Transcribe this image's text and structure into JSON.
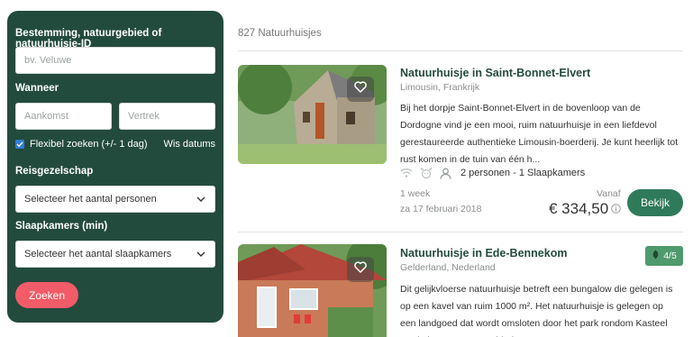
{
  "search": {
    "destination_label": "Bestemming, natuurgebied of natuurhuisje-ID",
    "destination_placeholder": "bv. Veluwe",
    "when_label": "Wanneer",
    "arrival_placeholder": "Aankomst",
    "departure_placeholder": "Vertrek",
    "flexible_label": "Flexibel zoeken (+/- 1 dag)",
    "flexible_checked": true,
    "clear_dates": "Wis datums",
    "party_label": "Reisgezelschap",
    "party_select": "Selecteer het aantal personen",
    "bedrooms_label": "Slaapkamers (min)",
    "bedrooms_select": "Selecteer het aantal slaapkamers",
    "search_button": "Zoeken"
  },
  "results": {
    "count_text": "827 Natuurhuisjes",
    "items": [
      {
        "title": "Natuurhuisje in Saint-Bonnet-Elvert",
        "location": "Limousin, Frankrijk",
        "description": "Bij het dorpje Saint-Bonnet-Elvert in de bovenloop van de Dordogne vind je een mooi, ruim natuurhuisje in een liefdevol gerestaureerde authentieke Limousin-boerderij. Je kunt heerlijk tot rust komen in de tuin van één h...",
        "amenity_icons": [
          "wifi-icon",
          "pet-icon",
          "person-icon"
        ],
        "capacity": "2 personen - 1 Slaapkamers",
        "duration": "1 week",
        "date": "za 17 februari 2018",
        "from_label": "Vanaf",
        "price": "€ 334,50",
        "view_button": "Bekijk"
      },
      {
        "title": "Natuurhuisje in Ede-Bennekom",
        "location": "Gelderland, Nederland",
        "description": "Dit gelijkvloerse natuurhuisje betreft een bungalow die gelegen is op een kavel van ruim 1000 m². Het natuurhuisje is gelegen op een landgoed dat wordt omsloten door het park rondom Kasteel Hoekelum en natuurgebied De Sy...",
        "rating": "4/5"
      }
    ]
  },
  "colors": {
    "sidebar_bg": "#234b3d",
    "accent_green": "#2f7a5a",
    "search_button": "#f25c68",
    "rating_badge": "#4f9a6c",
    "title_green": "#234b3d"
  }
}
